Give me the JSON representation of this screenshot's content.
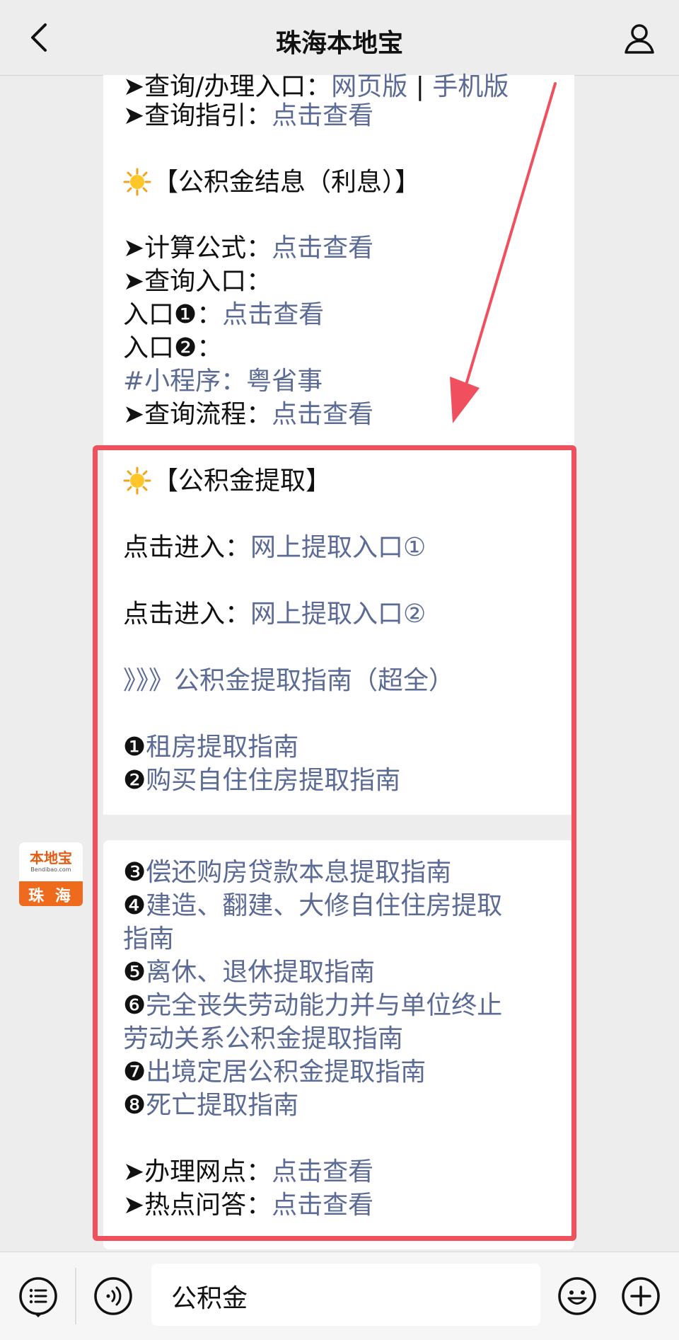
{
  "header": {
    "title": "珠海本地宝",
    "back_icon": "chevron-left-icon",
    "profile_icon": "user-icon"
  },
  "message1": {
    "lines": [
      {
        "prefix": "➤查询/办理入口：",
        "link": "网页版",
        "sep": " | ",
        "link2": "手机版"
      },
      {
        "prefix": "➤查询指引：",
        "link": "点击查看"
      },
      {
        "heading": "【公积金结息（利息）】"
      },
      {
        "prefix": "➤计算公式：",
        "link": "点击查看"
      },
      {
        "prefix": "➤查询入口："
      },
      {
        "prefix": "入口❶：",
        "link": "点击查看"
      },
      {
        "prefix": "入口❷："
      },
      {
        "link": "#小程序：粤省事"
      },
      {
        "prefix": "➤查询流程：",
        "link": "点击查看"
      },
      {
        "heading": "【公积金提取】"
      },
      {
        "prefix": "点击进入：",
        "link": "网上提取入口①"
      },
      {
        "prefix": "点击进入：",
        "link": "网上提取入口②"
      },
      {
        "link": "》》》公积金提取指南（超全）"
      },
      {
        "prefix": "❶",
        "link": "租房提取指南"
      },
      {
        "prefix": "❷",
        "link": "购买自住住房提取指南"
      }
    ]
  },
  "message2": {
    "lines": [
      {
        "prefix": "❸",
        "link": "偿还购房贷款本息提取指南"
      },
      {
        "prefix": "❹",
        "link": "建造、翻建、大修自住住房提取"
      },
      {
        "link": "指南"
      },
      {
        "prefix": "❺",
        "link": "离休、退休提取指南"
      },
      {
        "prefix": "❻",
        "link": "完全丧失劳动能力并与单位终止"
      },
      {
        "link": "劳动关系公积金提取指南"
      },
      {
        "prefix": "❼",
        "link": "出境定居公积金提取指南"
      },
      {
        "prefix": "❽",
        "link": "死亡提取指南"
      },
      {
        "prefix": "➤办理网点：",
        "link": "点击查看"
      },
      {
        "prefix": "➤热点问答：",
        "link": "点击查看"
      }
    ]
  },
  "avatar": {
    "brand": "本地宝",
    "domain": "Bendibao.com",
    "city": "珠 海"
  },
  "annotation": {
    "highlight_color": "#f0505d"
  },
  "input_bar": {
    "menu_icon": "list-menu-icon",
    "voice_icon": "voice-icon",
    "text": "公积金",
    "emoji_icon": "emoji-icon",
    "plus_icon": "plus-icon"
  },
  "colors": {
    "link": "#5b6b95",
    "background": "#ededed"
  }
}
